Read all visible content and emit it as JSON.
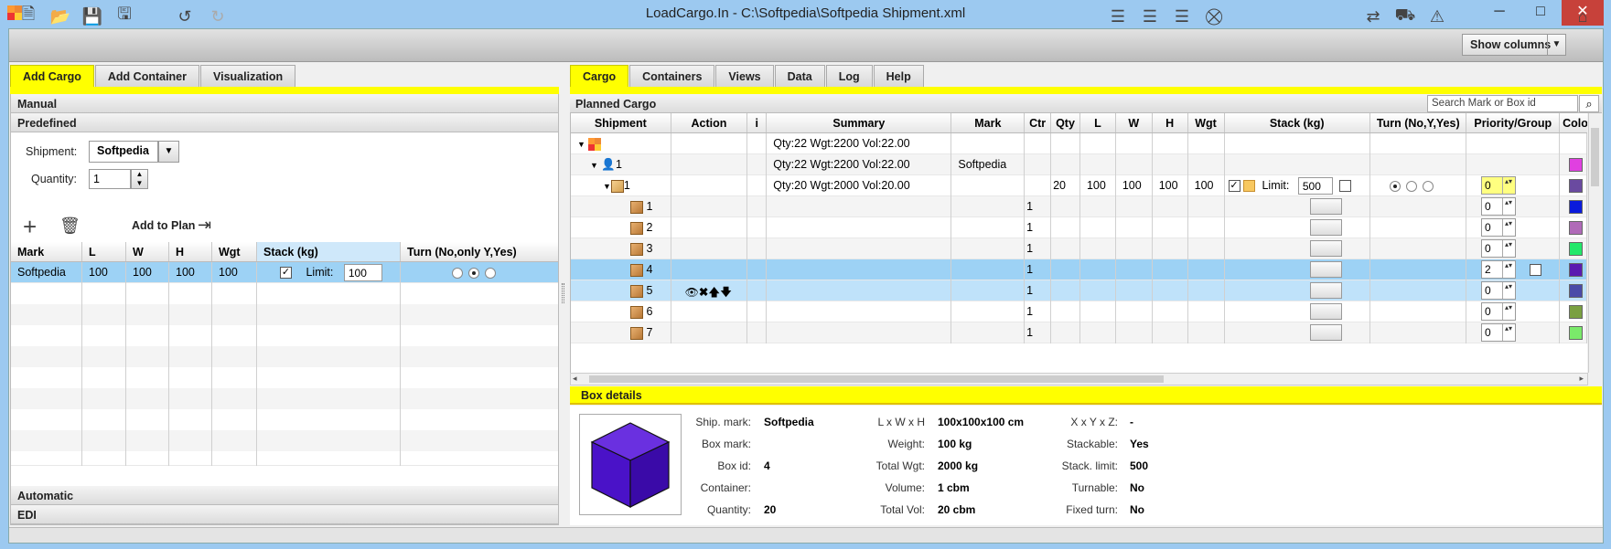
{
  "window": {
    "title": "LoadCargo.In - C:\\Softpedia\\Softpedia Shipment.xml",
    "minimize": "─",
    "maximize": "□",
    "close": "✕"
  },
  "toolbar": {
    "show_columns": "Show columns"
  },
  "left": {
    "tabs": [
      "Add Cargo",
      "Add Container",
      "Visualization"
    ],
    "sections": {
      "manual": "Manual",
      "predefined": "Predefined",
      "automatic": "Automatic",
      "edi": "EDI"
    },
    "shipment_label": "Shipment:",
    "shipment_value": "Softpedia",
    "quantity_label": "Quantity:",
    "quantity_value": "1",
    "add_to_plan": "Add to Plan",
    "columns": [
      "Mark",
      "L",
      "W",
      "H",
      "Wgt",
      "Stack (kg)",
      "Turn (No,only Y,Yes)"
    ],
    "row": {
      "mark": "Softpedia",
      "l": "100",
      "w": "100",
      "h": "100",
      "wgt": "100",
      "limit_label": "Limit:",
      "limit": "100"
    }
  },
  "right": {
    "tabs": [
      "Cargo",
      "Containers",
      "Views",
      "Data",
      "Log",
      "Help"
    ],
    "planned_cargo": "Planned Cargo",
    "search_placeholder": "Search Mark or Box id",
    "columns": [
      "Shipment",
      "Action",
      "i",
      "Summary",
      "Mark",
      "Ctr",
      "Qty",
      "L",
      "W",
      "H",
      "Wgt",
      "Stack (kg)",
      "Turn (No,Y,Yes)",
      "Priority/Group",
      "Colo"
    ],
    "root": {
      "summary": "Qty:22 Wgt:2200 Vol:22.00"
    },
    "shipper": {
      "id": "1",
      "summary": "Qty:22 Wgt:2200 Vol:22.00",
      "mark": "Softpedia"
    },
    "group": {
      "id": "1",
      "summary": "Qty:20 Wgt:2000 Vol:20.00",
      "qty": "20",
      "l": "100",
      "w": "100",
      "h": "100",
      "wgt": "100",
      "limit_label": "Limit:",
      "limit": "500",
      "priority": "0"
    },
    "boxes": [
      {
        "id": "1",
        "ctr": "1",
        "priority": "0",
        "color": "#0a1adc"
      },
      {
        "id": "2",
        "ctr": "1",
        "priority": "0",
        "color": "#b06ab8"
      },
      {
        "id": "3",
        "ctr": "1",
        "priority": "0",
        "color": "#22e86a"
      },
      {
        "id": "4",
        "ctr": "1",
        "priority": "2",
        "color": "#5a1ab0"
      },
      {
        "id": "5",
        "ctr": "1",
        "priority": "0",
        "color": "#4a4aa8"
      },
      {
        "id": "6",
        "ctr": "1",
        "priority": "0",
        "color": "#7aa040"
      },
      {
        "id": "7",
        "ctr": "1",
        "priority": "0",
        "color": "#7aea6a"
      }
    ],
    "shipper_color": "#e040e0",
    "group_color": "#6a4aa0"
  },
  "details": {
    "header": "Box details",
    "ship_mark_l": "Ship. mark:",
    "ship_mark": "Softpedia",
    "box_mark_l": "Box mark:",
    "box_mark": "",
    "box_id_l": "Box id:",
    "box_id": "4",
    "container_l": "Container:",
    "container": "",
    "quantity_l": "Quantity:",
    "quantity": "20",
    "dims_l": "L x W x H",
    "dims": "100x100x100 cm",
    "weight_l": "Weight:",
    "weight": "100 kg",
    "total_wgt_l": "Total Wgt:",
    "total_wgt": "2000 kg",
    "volume_l": "Volume:",
    "volume": "1 cbm",
    "total_vol_l": "Total Vol:",
    "total_vol": "20 cbm",
    "xyz_l": "X x Y x Z:",
    "xyz": "-",
    "stackable_l": "Stackable:",
    "stackable": "Yes",
    "stack_limit_l": "Stack. limit:",
    "stack_limit": "500",
    "turnable_l": "Turnable:",
    "turnable": "No",
    "fixed_turn_l": "Fixed turn:",
    "fixed_turn": "No",
    "cube_color": "#4a12c8"
  }
}
